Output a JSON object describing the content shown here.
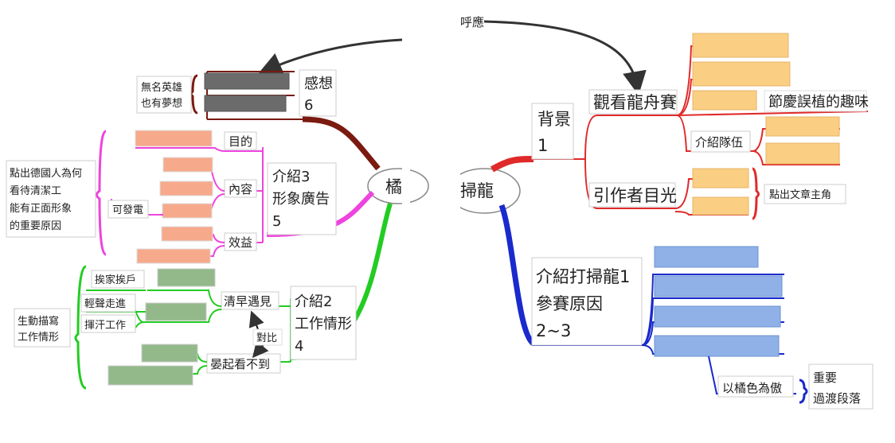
{
  "left_panel": {
    "center_node": "橘",
    "branch_brown": {
      "title": [
        "感想",
        "6"
      ],
      "sub": [
        "無名英雄",
        "也有夢想"
      ]
    },
    "branch_pink": {
      "title": [
        "介紹3",
        "形象廣告",
        "5"
      ],
      "items": [
        "目的",
        "內容",
        "效益"
      ],
      "mid_label": "可發電",
      "outer_note": [
        "點出德國人為何",
        "看待清潔工",
        "能有正面形象",
        "的重要原因"
      ]
    },
    "branch_green": {
      "title": [
        "介紹2",
        "工作情形",
        "4"
      ],
      "items": [
        "清早遇見",
        "晏起看不到"
      ],
      "contrast_label": "對比",
      "sub_items": [
        "挨家挨戶",
        "輕聲走進",
        "揮汗工作"
      ],
      "outer_note": [
        "生動描寫",
        "工作情形"
      ]
    }
  },
  "right_panel": {
    "top_partial_label": "呼應",
    "center_node": "掃龍",
    "branch_red": {
      "title": [
        "背景",
        "1"
      ],
      "items": [
        "觀看龍舟賽",
        "引作者目光"
      ],
      "sub_items": [
        "節慶誤植的趣味",
        "介紹隊伍"
      ],
      "outer_note": "點出文章主角"
    },
    "branch_blue": {
      "title": [
        "介紹打掃龍1",
        "參賽原因",
        "2~3"
      ],
      "sub_label": "以橘色為傲",
      "outer_note": [
        "重要",
        "過渡段落"
      ]
    }
  },
  "colors": {
    "brown": "#7a1a10",
    "pink": "#ee44dd",
    "green": "#22cc22",
    "red": "#e02a2a",
    "blue": "#1a2acc",
    "redaction_gray": "#6b6b6b",
    "redaction_salmon": "#f7a98b",
    "redaction_green": "#93b98a",
    "redaction_orange": "#fbcf83",
    "redaction_blue": "#8fb1e8"
  }
}
